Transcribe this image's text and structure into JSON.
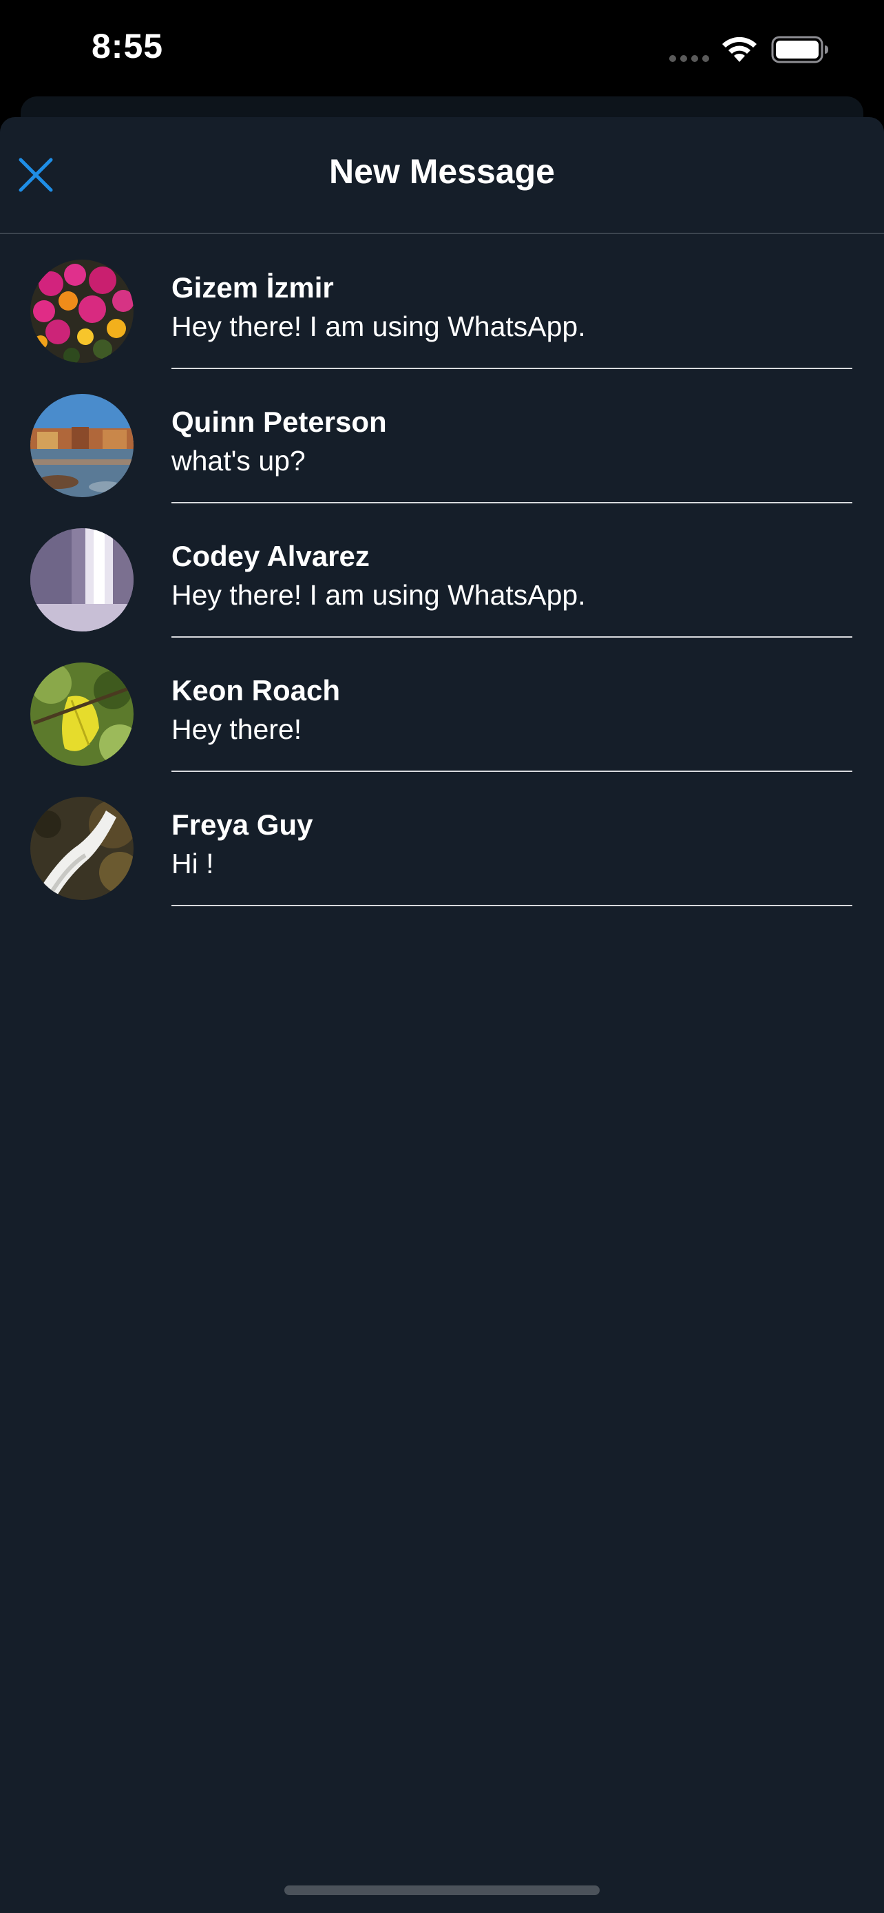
{
  "status_bar": {
    "time": "8:55",
    "signal_icon": "signal-dots-icon",
    "wifi_icon": "wifi-icon",
    "battery_icon": "battery-icon"
  },
  "header": {
    "title": "New Message",
    "close_icon": "close-icon"
  },
  "colors": {
    "background": "#151e29",
    "accent": "#1f8ee6",
    "text": "#ffffff",
    "divider": "#d8dadd"
  },
  "contacts": [
    {
      "name": "Gizem İzmir",
      "status": "Hey there! I am using WhatsApp.",
      "avatar": "flowers-avatar"
    },
    {
      "name": "Quinn Peterson",
      "status": "what's up?",
      "avatar": "river-town-avatar"
    },
    {
      "name": "Codey Alvarez",
      "status": "Hey there! I am using WhatsApp.",
      "avatar": "waterfall-avatar"
    },
    {
      "name": "Keon Roach",
      "status": "Hey there!",
      "avatar": "leaf-avatar"
    },
    {
      "name": "Freya Guy",
      "status": "Hi !",
      "avatar": "stream-avatar"
    }
  ]
}
